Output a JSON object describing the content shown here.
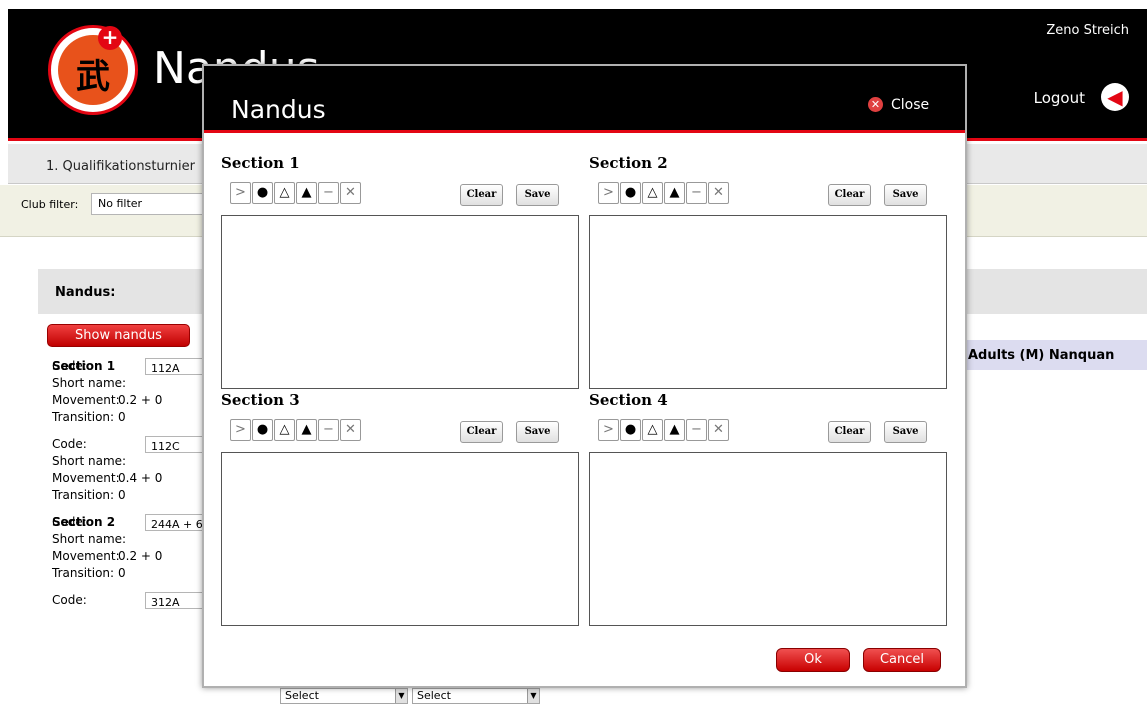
{
  "header": {
    "title": "Nandus",
    "username": "Zeno Streich",
    "logout_label": "Logout"
  },
  "tournament": {
    "label": "1. Qualifikationsturnier"
  },
  "filter": {
    "label": "Club filter:",
    "value": "No filter"
  },
  "nandus_panel": {
    "label": "Nandus:",
    "show_button": "Show nandus",
    "category": "Adults (M) Nanquan"
  },
  "background_form": {
    "sections": [
      {
        "title": "Section 1",
        "entries": [
          {
            "code": "112A",
            "short_name": "",
            "movement": "0.2 + 0",
            "transition": "0"
          },
          {
            "code": "112C",
            "short_name": "",
            "movement": "0.4 + 0",
            "transition": "0"
          }
        ]
      },
      {
        "title": "Section 2",
        "entries": [
          {
            "code": "244A + 6",
            "short_name": "",
            "movement": "0.2 + 0",
            "transition": "0"
          },
          {
            "code": "312A",
            "short_name": "",
            "movement": "",
            "transition": ""
          }
        ]
      }
    ],
    "labels": {
      "code": "Code:",
      "short_name": "Short name:",
      "movement": "Movement:",
      "transition": "Transition:"
    },
    "select_placeholder": "Select"
  },
  "modal": {
    "title": "Nandus",
    "close_label": "Close",
    "ok_label": "Ok",
    "cancel_label": "Cancel",
    "clear_label": "Clear",
    "save_label": "Save",
    "tool_icons": [
      "chevron-right-icon",
      "dot-icon",
      "triangle-outline-icon",
      "triangle-filled-icon",
      "dash-icon",
      "x-icon"
    ],
    "tool_glyphs": [
      ">",
      "●",
      "△",
      "▲",
      "−",
      "✕"
    ],
    "sections": [
      {
        "title": "Section 1"
      },
      {
        "title": "Section 2"
      },
      {
        "title": "Section 3"
      },
      {
        "title": "Section 4"
      }
    ]
  },
  "colors": {
    "accent": "#e30613",
    "header_bg": "#000000",
    "filter_bg": "#f1f1e4"
  }
}
